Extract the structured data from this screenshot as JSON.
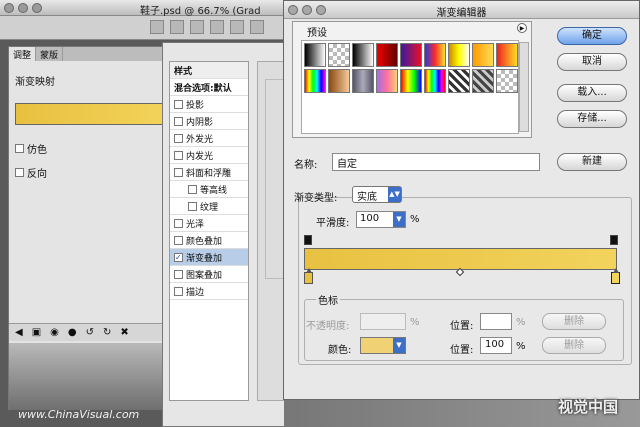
{
  "doc_window": {
    "title": "鞋子.psd @ 66.7% (Grad"
  },
  "adjust_panel": {
    "tabs": [
      "调整",
      "蒙版"
    ],
    "label": "渐变映射",
    "dither_label": "仿色",
    "reverse_label": "反向"
  },
  "layer_style": {
    "styles_header": "样式",
    "items": [
      {
        "label": "混合选项:默认",
        "checked": false,
        "indent": false,
        "header": true
      },
      {
        "label": "投影",
        "checked": false,
        "indent": false
      },
      {
        "label": "内阴影",
        "checked": false,
        "indent": false
      },
      {
        "label": "外发光",
        "checked": false,
        "indent": false
      },
      {
        "label": "内发光",
        "checked": false,
        "indent": false
      },
      {
        "label": "斜面和浮雕",
        "checked": false,
        "indent": false
      },
      {
        "label": "等高线",
        "checked": false,
        "indent": true
      },
      {
        "label": "纹理",
        "checked": false,
        "indent": true
      },
      {
        "label": "光泽",
        "checked": false,
        "indent": false
      },
      {
        "label": "颜色叠加",
        "checked": false,
        "indent": false
      },
      {
        "label": "渐变叠加",
        "checked": true,
        "indent": false,
        "selected": true
      },
      {
        "label": "图案叠加",
        "checked": false,
        "indent": false
      },
      {
        "label": "描边",
        "checked": false,
        "indent": false
      }
    ]
  },
  "gradient_editor": {
    "title": "渐变编辑器",
    "presets_label": "预设",
    "buttons": {
      "ok": "确定",
      "cancel": "取消",
      "load": "载入...",
      "save": "存储...",
      "new": "新建"
    },
    "name_label": "名称:",
    "name_value": "自定",
    "type_label": "渐变类型:",
    "type_value": "实底",
    "smoothness_label": "平滑度:",
    "smoothness_value": "100",
    "smoothness_unit": "%",
    "stops_section": "色标",
    "opacity_label": "不透明度:",
    "opacity_unit": "%",
    "position_label": "位置:",
    "position_unit": "%",
    "delete_label": "删除",
    "color_label": "颜色:",
    "color_position_value": "100",
    "ramp_start_color": "#e8c141",
    "ramp_end_color": "#f2d35c",
    "selected_stop_color": "#f0d275"
  },
  "presets": [
    "linear-gradient(90deg,#000,#fff)",
    "repeating-conic-gradient(#bbb 0 25%,#fff 0 50%) 0 0/8px 8px",
    "linear-gradient(90deg,#000,#fff)",
    "linear-gradient(90deg,#e00,#600)",
    "linear-gradient(90deg,#3a1aa0,#e8102a)",
    "linear-gradient(90deg,#2a3ae0,#ff2a2a,#ffe02a)",
    "linear-gradient(90deg,#c80,#ff0,#fff)",
    "linear-gradient(90deg,#f90,#fd5)",
    "linear-gradient(90deg,#e22,#fd2)",
    "linear-gradient(90deg,#f00,#ff0,#0f0,#0ff,#00f,#f0f)",
    "linear-gradient(90deg,#8a4a10,#f6c89a)",
    "linear-gradient(90deg,#556,#aab,#556)",
    "linear-gradient(90deg,#a070e0,#ff70a0,#ffd070)",
    "linear-gradient(90deg,#f00,#ff0,#0f0,#00f)",
    "linear-gradient(90deg,#f00,#ff0,#0f0,#0ff,#00f,#f0f,#f00)",
    "repeating-linear-gradient(45deg,#333 0 3px,#fff 3px 6px)",
    "repeating-linear-gradient(45deg,#444 0 3px,#ccc 3px 6px)",
    "repeating-conic-gradient(#bbb 0 25%,#fff 0 50%) 0 0/8px 8px"
  ],
  "watermark_left": "www.ChinaVisual.com",
  "watermark_right": "视觉中国"
}
